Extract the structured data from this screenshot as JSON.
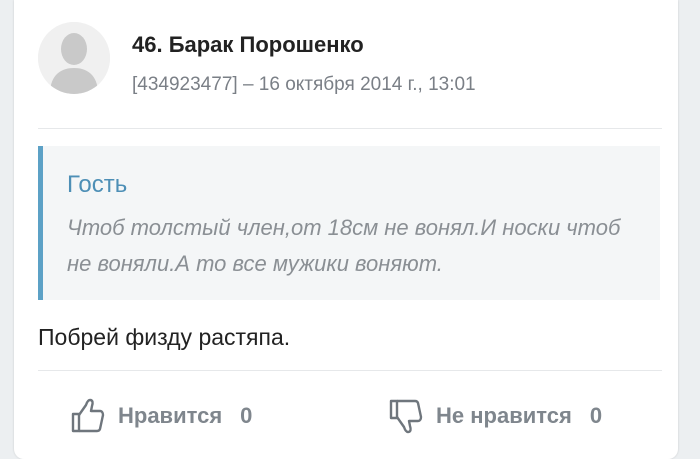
{
  "post": {
    "author": "46. Барак Порошенко",
    "meta": "[434923477] – 16 октября 2014 г., 13:01",
    "quote": {
      "author": "Гость",
      "text": "Чтоб толстый член,от 18см не вонял.И носки чтоб не воняли.А то все мужики воняют."
    },
    "text": "Побрей физду растяпа."
  },
  "actions": {
    "like": {
      "icon": "thumbs-up-icon",
      "label": "Нравится",
      "count": "0"
    },
    "dislike": {
      "icon": "thumbs-down-icon",
      "label": "Не нравится",
      "count": "0"
    }
  },
  "colors": {
    "quote_accent": "#5ca1c6",
    "quote_author": "#4d8fb6",
    "muted": "#7f868d"
  }
}
